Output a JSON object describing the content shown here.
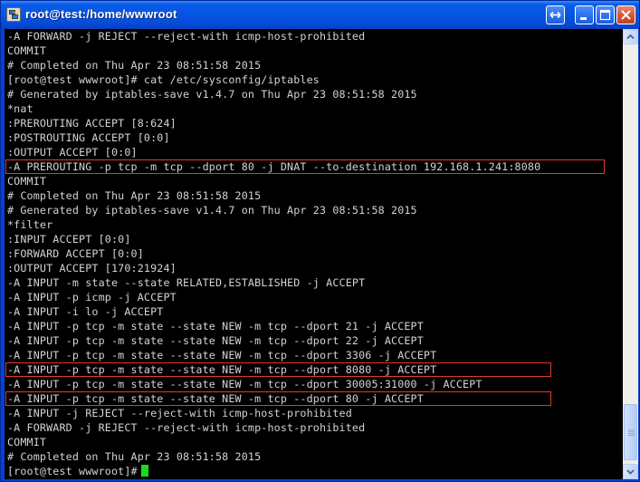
{
  "window": {
    "title": "root@test:/home/wwwroot",
    "buttons": [
      "restore-size",
      "minimize",
      "maximize",
      "close"
    ]
  },
  "terminal": {
    "lines": [
      "-A FORWARD -j REJECT --reject-with icmp-host-prohibited",
      "COMMIT",
      "# Completed on Thu Apr 23 08:51:58 2015",
      "[root@test wwwroot]# cat /etc/sysconfig/iptables",
      "# Generated by iptables-save v1.4.7 on Thu Apr 23 08:51:58 2015",
      "*nat",
      ":PREROUTING ACCEPT [8:624]",
      ":POSTROUTING ACCEPT [0:0]",
      ":OUTPUT ACCEPT [0:0]",
      "-A PREROUTING -p tcp -m tcp --dport 80 -j DNAT --to-destination 192.168.1.241:8080",
      "COMMIT",
      "# Completed on Thu Apr 23 08:51:58 2015",
      "# Generated by iptables-save v1.4.7 on Thu Apr 23 08:51:58 2015",
      "*filter",
      ":INPUT ACCEPT [0:0]",
      ":FORWARD ACCEPT [0:0]",
      ":OUTPUT ACCEPT [170:21924]",
      "-A INPUT -m state --state RELATED,ESTABLISHED -j ACCEPT",
      "-A INPUT -p icmp -j ACCEPT",
      "-A INPUT -i lo -j ACCEPT",
      "-A INPUT -p tcp -m state --state NEW -m tcp --dport 21 -j ACCEPT",
      "-A INPUT -p tcp -m state --state NEW -m tcp --dport 22 -j ACCEPT",
      "-A INPUT -p tcp -m state --state NEW -m tcp --dport 3306 -j ACCEPT",
      "-A INPUT -p tcp -m state --state NEW -m tcp --dport 8080 -j ACCEPT",
      "-A INPUT -p tcp -m state --state NEW -m tcp --dport 30005:31000 -j ACCEPT",
      "-A INPUT -p tcp -m state --state NEW -m tcp --dport 80 -j ACCEPT",
      "-A INPUT -j REJECT --reject-with icmp-host-prohibited",
      "-A FORWARD -j REJECT --reject-with icmp-host-prohibited",
      "COMMIT",
      "# Completed on Thu Apr 23 08:51:58 2015"
    ],
    "prompt": "[root@test wwwroot]#",
    "highlighted_lines": [
      9,
      23,
      25
    ],
    "highlight_color": "#e03a2a",
    "cursor_color": "#1ed81e",
    "text_color": "#d3d3d3",
    "background_color": "#000000"
  },
  "scrollbar": {
    "position_fraction": 0.93
  }
}
